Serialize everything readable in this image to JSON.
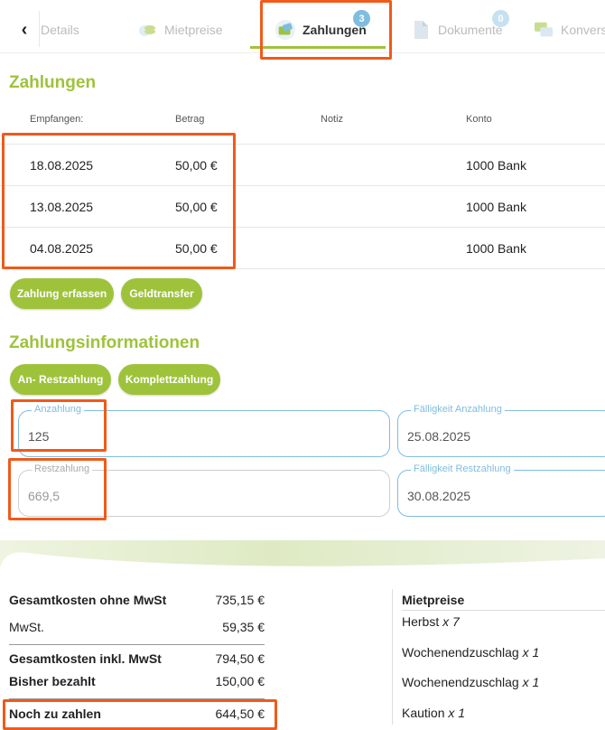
{
  "tabs": {
    "items": [
      {
        "label": "Details"
      },
      {
        "label": "Mietpreise"
      },
      {
        "label": "Zahlungen",
        "badge": "3",
        "active": true
      },
      {
        "label": "Dokumente",
        "badge": "0"
      },
      {
        "label": "Konvers"
      }
    ]
  },
  "payments": {
    "title": "Zahlungen",
    "columns": [
      "Empfangen:",
      "Betrag",
      "Notiz",
      "Konto"
    ],
    "rows": [
      {
        "date": "18.08.2025",
        "amount": "50,00 €",
        "note": "",
        "account": "1000 Bank"
      },
      {
        "date": "13.08.2025",
        "amount": "50,00 €",
        "note": "",
        "account": "1000 Bank"
      },
      {
        "date": "04.08.2025",
        "amount": "50,00 €",
        "note": "",
        "account": "1000 Bank"
      }
    ],
    "buttons": {
      "record": "Zahlung erfassen",
      "transfer": "Geldtransfer"
    }
  },
  "payment_info": {
    "title": "Zahlungsinformationen",
    "buttons": {
      "partial": "An- Restzahlung",
      "full": "Komplettzahlung"
    },
    "fields": {
      "deposit": {
        "label": "Anzahlung",
        "value": "125"
      },
      "deposit_due": {
        "label": "Fälligkeit Anzahlung",
        "value": "25.08.2025"
      },
      "remaining": {
        "label": "Restzahlung",
        "value": "669,5"
      },
      "remaining_due": {
        "label": "Fälligkeit Restzahlung",
        "value": "30.08.2025"
      }
    }
  },
  "totals": {
    "net": {
      "label": "Gesamtkosten ohne MwSt",
      "value": "735,15 €"
    },
    "vat": {
      "label": "MwSt.",
      "value": "59,35 €"
    },
    "gross": {
      "label": "Gesamtkosten inkl. MwSt",
      "value": "794,50 €"
    },
    "paid": {
      "label": "Bisher bezahlt",
      "value": "150,00 €"
    },
    "due": {
      "label": "Noch zu zahlen",
      "value": "644,50 €"
    }
  },
  "mietpreise": {
    "title": "Mietpreise",
    "items": [
      {
        "name": "Herbst",
        "mult": "x 7"
      },
      {
        "name": "Wochenendzuschlag",
        "mult": "x 1"
      },
      {
        "name": "Wochenendzuschlag",
        "mult": "x 1"
      },
      {
        "name": "Kaution",
        "mult": "x 1"
      }
    ]
  },
  "colors": {
    "accent": "#9ec33b",
    "highlight": "#f05a1a",
    "field_border": "#7fbde0"
  }
}
